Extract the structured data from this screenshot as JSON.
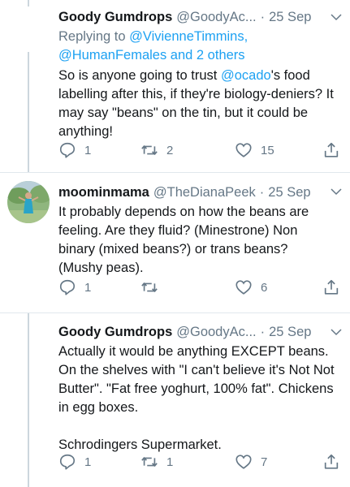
{
  "tweets": [
    {
      "name": "Goody Gumdrops",
      "handle": "@GoodyAc...",
      "dot": "·",
      "time": "25 Sep",
      "replying_prefix": "Replying to ",
      "replying_user1": "@VivienneTimmins",
      "replying_comma": ",",
      "replying_user2": "@HumanFemales",
      "replying_rest": " and 2 others",
      "text_before": "So is anyone going to trust ",
      "text_mention": "@ocado",
      "text_after": "'s food labelling after this, if they're biology-deniers? It may say \"beans\" on the tin, but it could be anything!",
      "replies": "1",
      "retweets": "2",
      "likes": "15"
    },
    {
      "name": "moominmama",
      "handle": "@TheDianaPeek",
      "dot": "·",
      "time": "25 Sep",
      "text": "It probably depends on how the beans are feeling. Are they fluid? (Minestrone) Non binary (mixed beans?) or trans beans? (Mushy peas).",
      "replies": "1",
      "retweets": "",
      "likes": "6"
    },
    {
      "name": "Goody Gumdrops",
      "handle": "@GoodyAc...",
      "dot": "·",
      "time": "25 Sep",
      "text": "Actually it would be anything EXCEPT beans. On the shelves with \"I can't believe it's Not Not Butter\". \"Fat free yoghurt, 100% fat\". Chickens in egg boxes.\n\nSchrodingers Supermarket.",
      "replies": "1",
      "retweets": "1",
      "likes": "7"
    }
  ],
  "icons": {
    "reply": "reply-icon",
    "retweet": "retweet-icon",
    "like": "heart-icon",
    "share": "share-icon",
    "menu": "chevron-down-icon"
  },
  "colors": {
    "link": "#1da1f2",
    "muted": "#657786",
    "thread_line": "#ccd6dd"
  }
}
